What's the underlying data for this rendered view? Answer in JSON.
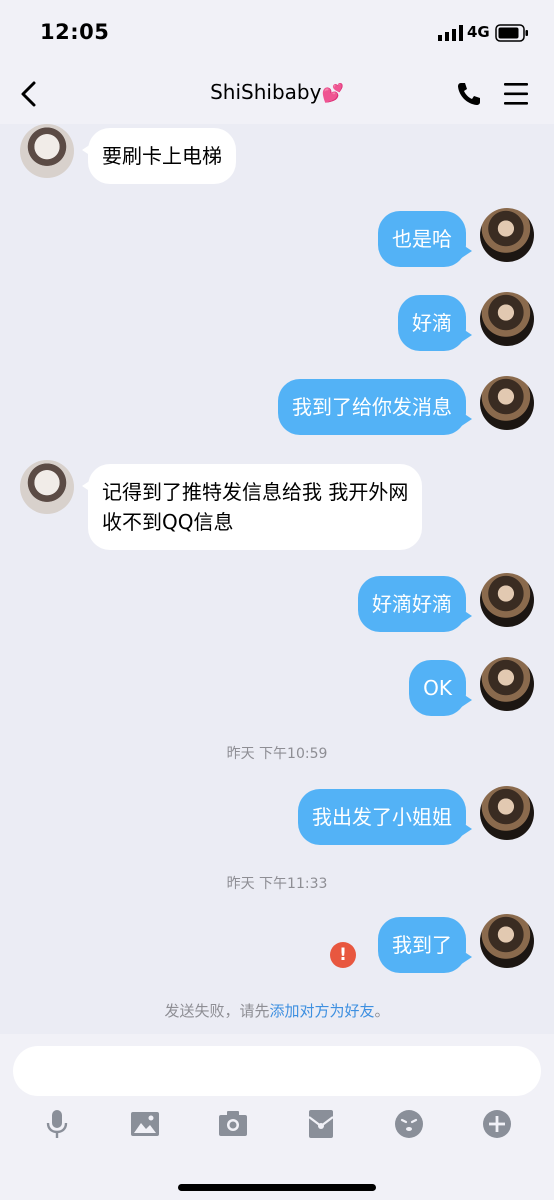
{
  "status_bar": {
    "time": "12:05",
    "network": "4G"
  },
  "header": {
    "contact_name": "ShiShibaby",
    "contact_emoji": "💕"
  },
  "messages": [
    {
      "sender": "peer",
      "text": "要刷卡上电梯"
    },
    {
      "sender": "me",
      "text": "也是哈"
    },
    {
      "sender": "me",
      "text": "好滴"
    },
    {
      "sender": "me",
      "text": "我到了给你发消息"
    },
    {
      "sender": "peer",
      "text_line1": "记得到了推特发信息给我 我开外网",
      "text_line2": "收不到QQ信息"
    },
    {
      "sender": "me",
      "text": "好滴好滴"
    },
    {
      "sender": "me",
      "text": "OK"
    },
    {
      "sender": "me",
      "text": "我出发了小姐姐"
    },
    {
      "sender": "me",
      "text": "我到了",
      "status": "failed"
    }
  ],
  "timestamps": [
    "昨天 下午10:59",
    "昨天 下午11:33"
  ],
  "error_icon_text": "!",
  "fail_notice": {
    "prefix": "发送失败，请先",
    "link": "添加对方为好友",
    "suffix": "。"
  },
  "input": {
    "value": "",
    "placeholder": ""
  },
  "toolbar_icons": [
    "microphone-icon",
    "image-icon",
    "camera-icon",
    "red-packet-icon",
    "emoji-icon",
    "plus-icon"
  ],
  "colors": {
    "background": "#ebecf4",
    "bubble_out": "#53b2f6",
    "bubble_in": "#ffffff",
    "error": "#e8573f",
    "link": "#3d8fe0"
  }
}
